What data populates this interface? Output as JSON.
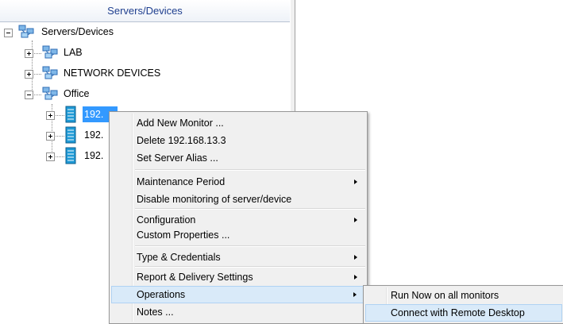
{
  "panel": {
    "header": "Servers/Devices"
  },
  "tree": {
    "root": {
      "label": "Servers/Devices",
      "icon": "network-group-icon"
    },
    "groups": [
      {
        "label": "LAB",
        "expanded": false
      },
      {
        "label": "NETWORK DEVICES",
        "expanded": false
      },
      {
        "label": "Office",
        "expanded": true
      }
    ],
    "servers": [
      {
        "label": "192.",
        "selected": true
      },
      {
        "label": "192."
      },
      {
        "label": "192."
      }
    ]
  },
  "context_menu": {
    "items": [
      {
        "label": "Add New Monitor ..."
      },
      {
        "label": "Delete 192.168.13.3"
      },
      {
        "label": "Set Server Alias ..."
      },
      {
        "label": "Maintenance Period",
        "submenu": true
      },
      {
        "label": "Disable monitoring of server/device"
      },
      {
        "label": "Configuration",
        "submenu": true
      },
      {
        "label": "Custom Properties ..."
      },
      {
        "label": "Type & Credentials",
        "submenu": true
      },
      {
        "label": "Report & Delivery Settings",
        "submenu": true
      },
      {
        "label": "Operations",
        "submenu": true,
        "active": true
      },
      {
        "label": "Notes ..."
      }
    ]
  },
  "operations_submenu": {
    "items": [
      {
        "label": "Run Now on all monitors"
      },
      {
        "label": "Connect with Remote Desktop",
        "active": true
      }
    ]
  },
  "colors": {
    "selection": "#3399ff",
    "menu_highlight": "#d9eaf9",
    "header_text": "#1f3f8f"
  }
}
